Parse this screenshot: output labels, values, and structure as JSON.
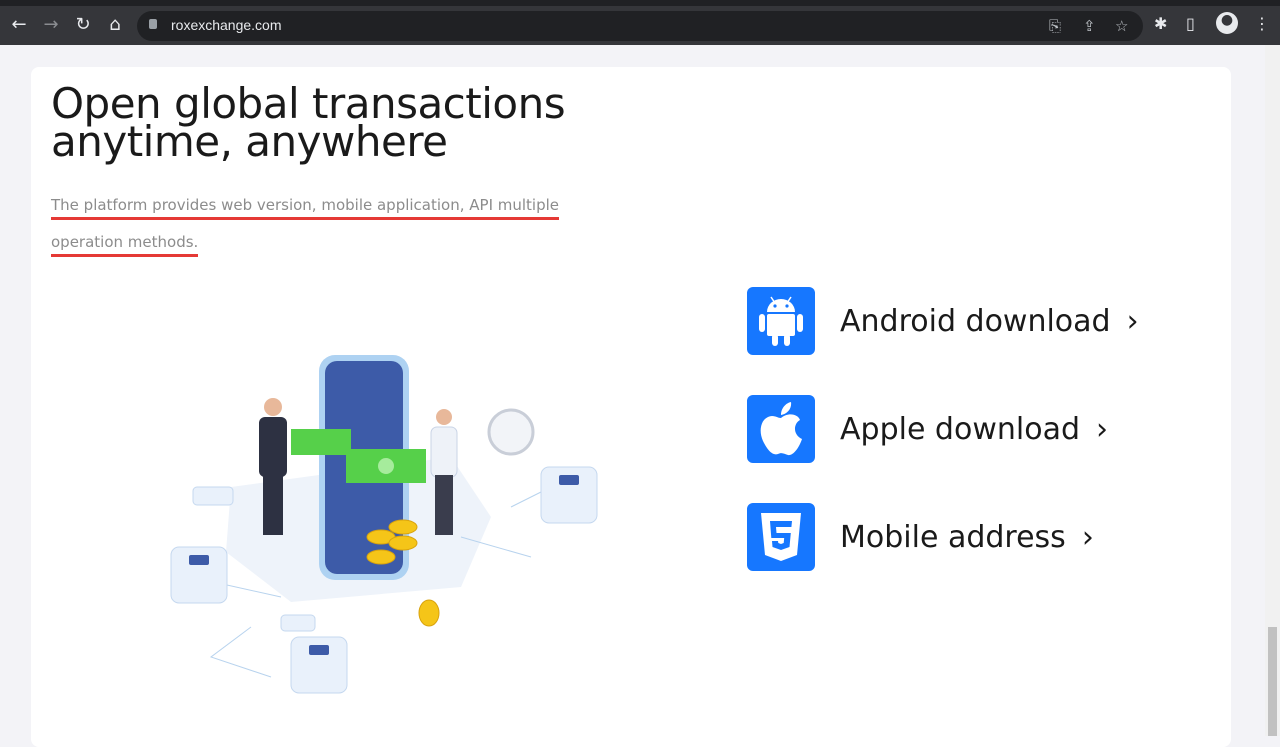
{
  "browser": {
    "url": "roxexchange.com"
  },
  "hero": {
    "title": "Open global transactions anytime, anywhere",
    "subtitle_line1": "The platform provides web version, mobile application, API multiple",
    "subtitle_line2": "operation methods."
  },
  "downloads": [
    {
      "label": "Android download",
      "icon": "android-icon"
    },
    {
      "label": "Apple download",
      "icon": "apple-icon"
    },
    {
      "label": "Mobile address",
      "icon": "html5-icon"
    }
  ],
  "colors": {
    "accent": "#1677ff",
    "underline": "#e53935"
  }
}
